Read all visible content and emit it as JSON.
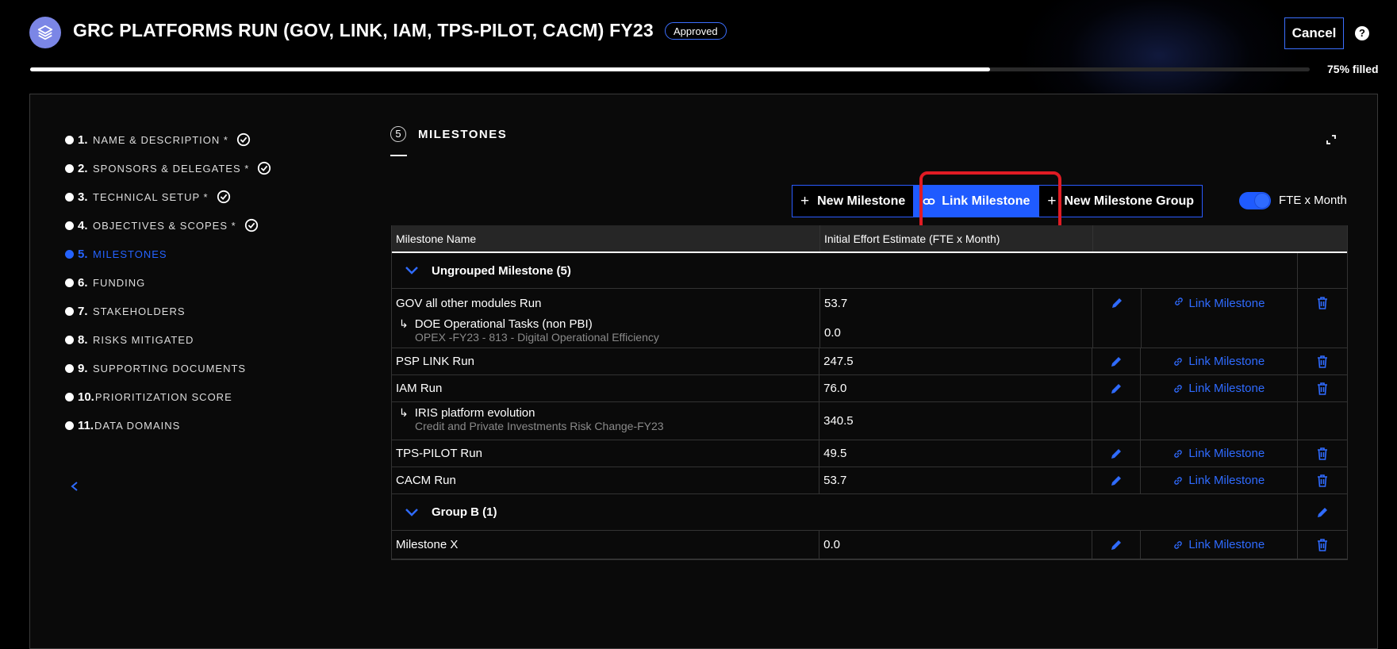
{
  "header": {
    "title": "GRC PLATFORMS RUN (GOV, LINK, IAM, TPS-PILOT, CACM) FY23",
    "status_badge": "Approved",
    "cancel_label": "Cancel",
    "help_glyph": "?",
    "progress_fraction": 0.75,
    "progress_text": "75% filled"
  },
  "steps": [
    {
      "num": "1.",
      "label": "NAME & DESCRIPTION *",
      "done": true
    },
    {
      "num": "2.",
      "label": "SPONSORS & DELEGATES *",
      "done": true
    },
    {
      "num": "3.",
      "label": "TECHNICAL SETUP *",
      "done": true
    },
    {
      "num": "4.",
      "label": "OBJECTIVES & SCOPES *",
      "done": true
    },
    {
      "num": "5.",
      "label": "MILESTONES",
      "active": true
    },
    {
      "num": "6.",
      "label": "FUNDING"
    },
    {
      "num": "7.",
      "label": "STAKEHOLDERS"
    },
    {
      "num": "8.",
      "label": "RISKS MITIGATED"
    },
    {
      "num": "9.",
      "label": "SUPPORTING DOCUMENTS"
    },
    {
      "num": "10.",
      "label": "PRIORITIZATION SCORE"
    },
    {
      "num": "11.",
      "label": "DATA DOMAINS"
    }
  ],
  "section": {
    "number": "5",
    "title": "MILESTONES"
  },
  "toolbar": {
    "new_milestone": "New Milestone",
    "link_milestone": "Link Milestone",
    "new_group": "New Milestone Group",
    "toggle_label": "FTE x Month",
    "toggle_on": true
  },
  "table": {
    "columns": [
      "Milestone Name",
      "Initial Effort Estimate (FTE x Month)"
    ],
    "link_label": "Link Milestone",
    "groups": [
      {
        "name": "Ungrouped Milestone (5)"
      },
      {
        "name": "Group B (1)"
      }
    ],
    "rows": {
      "r1": {
        "name": "GOV all other modules Run",
        "value": "53.7"
      },
      "r1s": {
        "name": "DOE Operational Tasks (non PBI)",
        "sub": "OPEX -FY23 - 813 - Digital Operational Efficiency",
        "value": "0.0"
      },
      "r2": {
        "name": "PSP LINK Run",
        "value": "247.5"
      },
      "r3": {
        "name": "IAM Run",
        "value": "76.0"
      },
      "r3s": {
        "name": "IRIS platform evolution",
        "sub": "Credit and Private Investments Risk Change-FY23",
        "value": "340.5"
      },
      "r4": {
        "name": "TPS-PILOT Run",
        "value": "49.5"
      },
      "r5": {
        "name": "CACM Run",
        "value": "53.7"
      },
      "r6": {
        "name": "Milestone X",
        "value": "0.0"
      }
    }
  },
  "colors": {
    "accent": "#1f5bff",
    "highlight": "#e01b24",
    "background": "#000000"
  }
}
